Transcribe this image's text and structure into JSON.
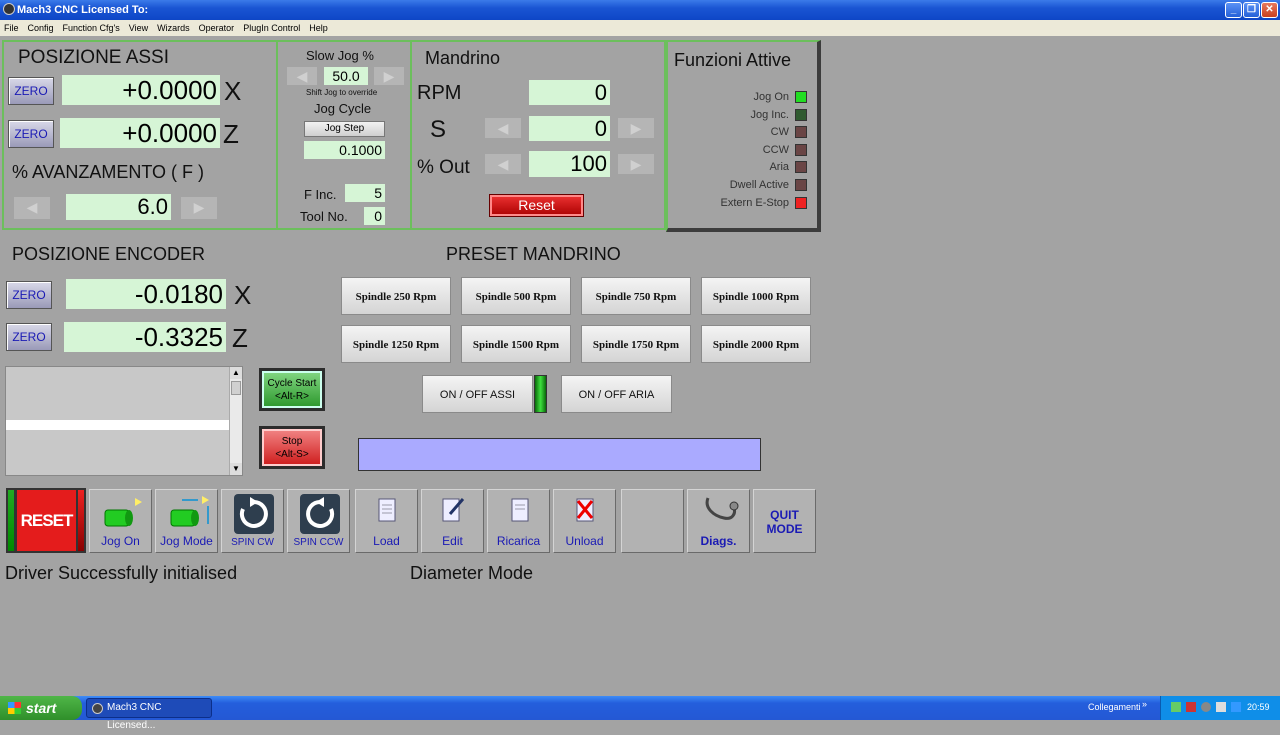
{
  "window": {
    "title": "Mach3 CNC  Licensed To:"
  },
  "menu": [
    "File",
    "Config",
    "Function Cfg's",
    "View",
    "Wizards",
    "Operator",
    "PlugIn Control",
    "Help"
  ],
  "axes_panel": {
    "title": "POSIZIONE ASSI",
    "zero_label": "ZERO",
    "x_value": "+0.0000",
    "x_axis": "X",
    "z_value": "+0.0000",
    "z_axis": "Z",
    "feed_label": "% AVANZAMENTO ( F )",
    "feed_value": "6.0"
  },
  "jog_panel": {
    "slow_jog_label": "Slow Jog %",
    "slow_jog_value": "50.0",
    "shift_hint": "Shift Jog to override",
    "jog_cycle_label": "Jog Cycle",
    "jog_step_button": "Jog Step",
    "jog_step_value": "0.1000",
    "f_inc_label": "F Inc.",
    "f_inc_value": "5",
    "tool_label": "Tool No.",
    "tool_value": "0"
  },
  "spindle_panel": {
    "title": "Mandrino",
    "rpm_label": "RPM",
    "rpm_value": "0",
    "s_label": "S",
    "s_value": "0",
    "out_label": "% Out",
    "out_value": "100",
    "reset_label": "Reset"
  },
  "functions_panel": {
    "title": "Funzioni Attive",
    "leds": [
      {
        "label": "Jog On",
        "color": "#22dd22"
      },
      {
        "label": "Jog Inc.",
        "color": "#2f5a2f"
      },
      {
        "label": "CW",
        "color": "#6a4545"
      },
      {
        "label": "CCW",
        "color": "#6a4545"
      },
      {
        "label": "Aria",
        "color": "#6a4545"
      },
      {
        "label": "Dwell Active",
        "color": "#6a4545"
      },
      {
        "label": "Extern E-Stop",
        "color": "#ee2222"
      }
    ]
  },
  "encoder_panel": {
    "title": "POSIZIONE ENCODER",
    "x_value": "-0.0180",
    "x_axis": "X",
    "z_value": "-0.3325",
    "z_axis": "Z"
  },
  "preset_panel": {
    "title": "PRESET MANDRINO",
    "buttons": [
      "Spindle 250 Rpm",
      "Spindle 500 Rpm",
      "Spindle 750 Rpm",
      "Spindle 1000 Rpm",
      "Spindle 1250 Rpm",
      "Spindle 1500 Rpm",
      "Spindle 1750 Rpm",
      "Spindle 2000 Rpm"
    ],
    "axes_toggle": "ON / OFF ASSI",
    "air_toggle": "ON / OFF ARIA"
  },
  "cycle": {
    "start_line1": "Cycle Start",
    "start_line2": "<Alt-R>",
    "stop_line1": "Stop",
    "stop_line2": "<Alt-S>"
  },
  "toolbar": {
    "reset": "RESET",
    "jog_on": "Jog On",
    "jog_mode": "Jog Mode",
    "spin_cw": "SPIN CW",
    "spin_ccw": "SPIN CCW",
    "load": "Load",
    "edit": "Edit",
    "reload": "Ricarica",
    "unload": "Unload",
    "diags": "Diags.",
    "quit_line1": "QUIT",
    "quit_line2": "MODE"
  },
  "status": {
    "left": "Driver Successfully initialised",
    "right": "Diameter Mode"
  },
  "taskbar": {
    "start": "start",
    "task": "Mach3 CNC  Licensed...",
    "links": "Collegamenti",
    "clock": "20:59"
  }
}
